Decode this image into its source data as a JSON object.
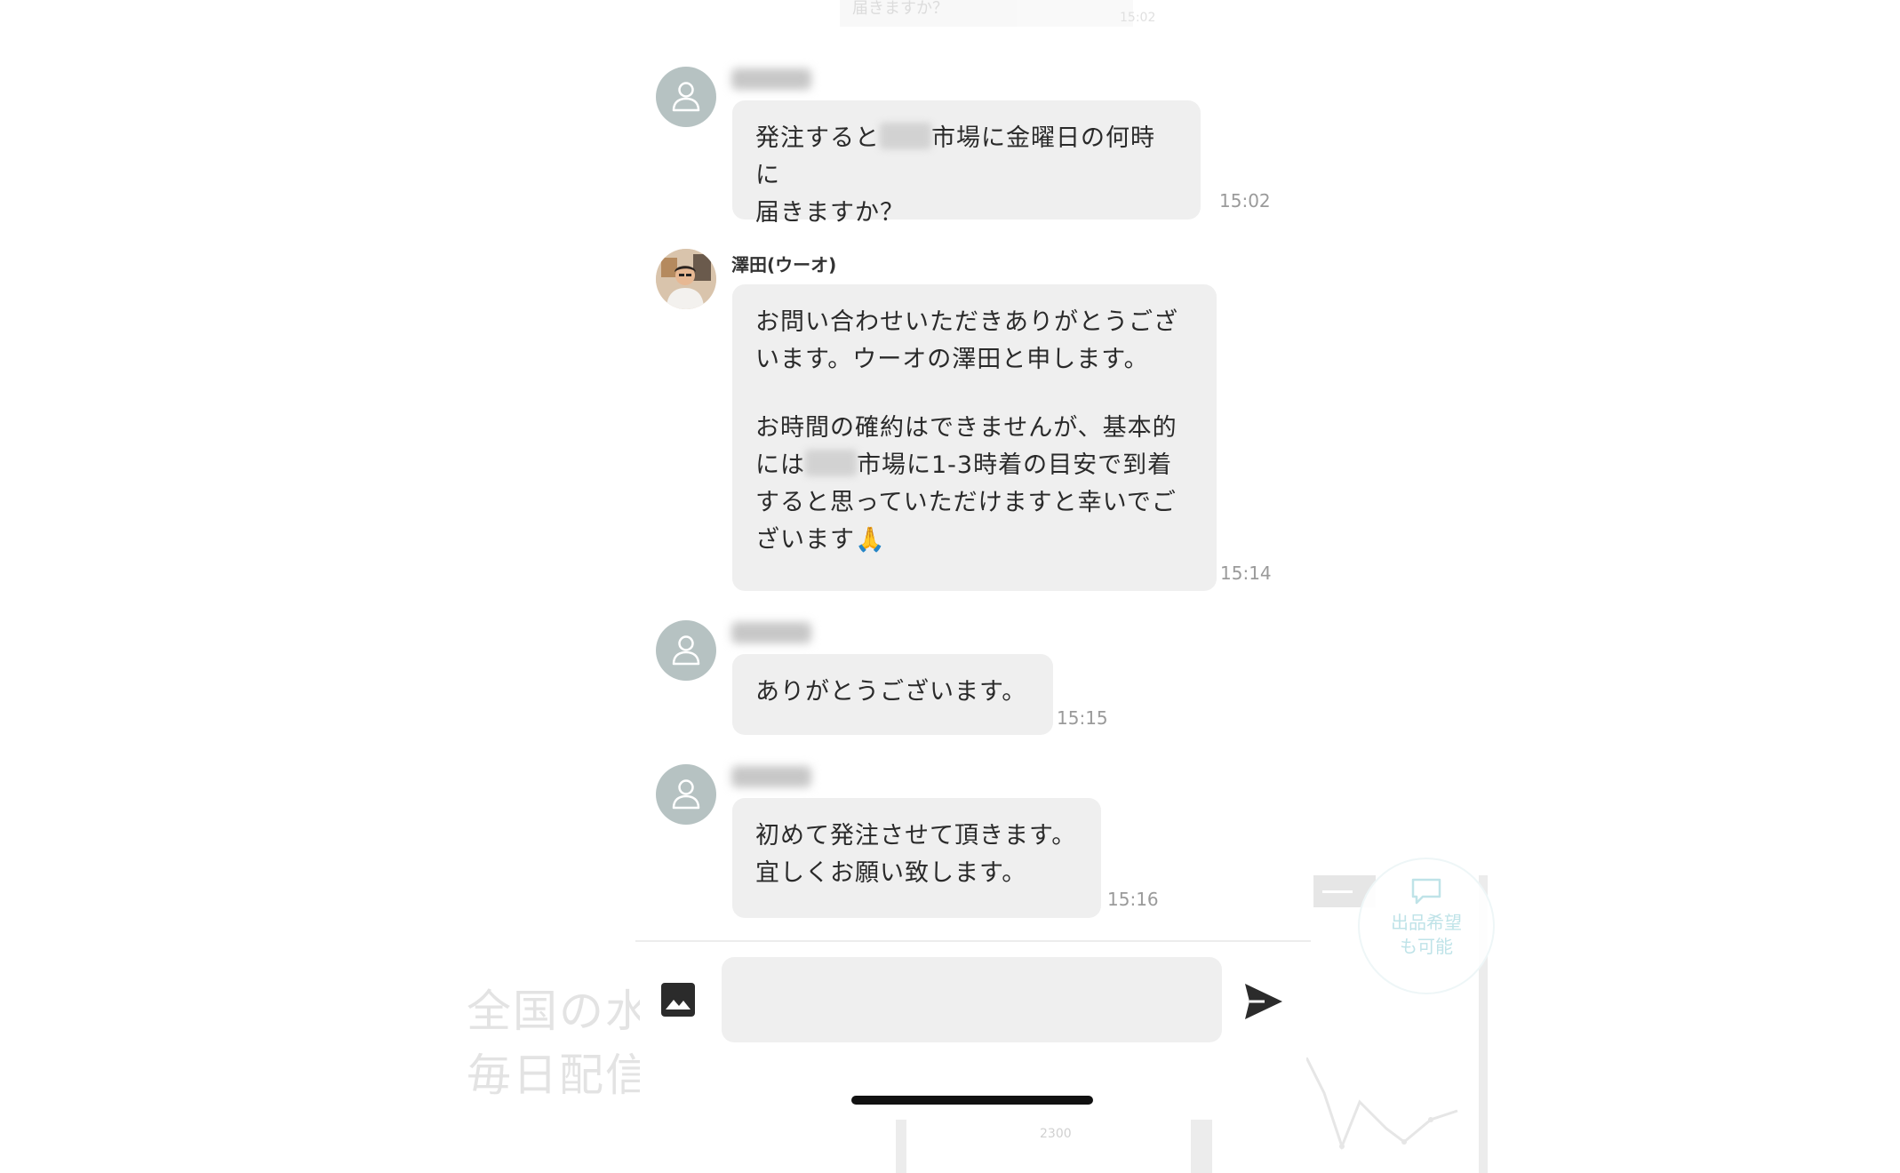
{
  "background_site": {
    "headline_line1": "全国の水",
    "headline_line2": "毎日配信",
    "badge_line1": "出品希望",
    "badge_line2": "も可能",
    "mock_price": "2300"
  },
  "top_partial": {
    "text": "届きますか？",
    "time": "15:02"
  },
  "messages": [
    {
      "sender": "",
      "text_before": "発注すると",
      "text_after": "市場に金曜日の何時に\n届きますか？",
      "time": "15:02"
    },
    {
      "sender": "澤田(ウーオ)",
      "paragraph1": "お問い合わせいただきありがとうござ\nいます。ウーオの澤田と申します。",
      "p2_before": "お時間の確約はできませんが、基本的\nには",
      "p2_after": "市場に1-3時着の目安で到着\nすると思っていただけますと幸いでご\nざいます🙏",
      "time": "15:14"
    },
    {
      "sender": "",
      "text": "ありがとうございます。",
      "time": "15:15"
    },
    {
      "sender": "",
      "text": "初めて発注させて頂きます。\n宜しくお願い致します。",
      "time": "15:16"
    }
  ],
  "composer": {
    "placeholder": ""
  },
  "icons": {
    "image": "image-icon",
    "send": "send-icon",
    "avatar": "user-icon"
  },
  "colors": {
    "bubble": "#efefef",
    "avatar_default": "#b6c2c2",
    "time_text": "#9a9a9a"
  }
}
